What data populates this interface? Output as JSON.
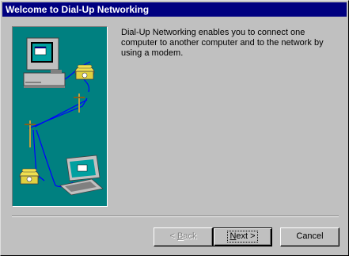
{
  "window": {
    "title": "Welcome to Dial-Up Networking"
  },
  "description": "Dial-Up Networking enables you to connect one computer to another computer and to the network by using a modem.",
  "buttons": {
    "back": {
      "mnemonic": "B",
      "rest": "ack",
      "prefix": "< ",
      "enabled": false
    },
    "next": {
      "mnemonic": "N",
      "rest": "ext >",
      "enabled": true
    },
    "cancel": {
      "label": "Cancel"
    }
  },
  "illustration": {
    "background": "#008080",
    "items": [
      "desktop-computer-icon",
      "telephone-icon",
      "telephone-pole-icon",
      "laptop-icon"
    ]
  }
}
